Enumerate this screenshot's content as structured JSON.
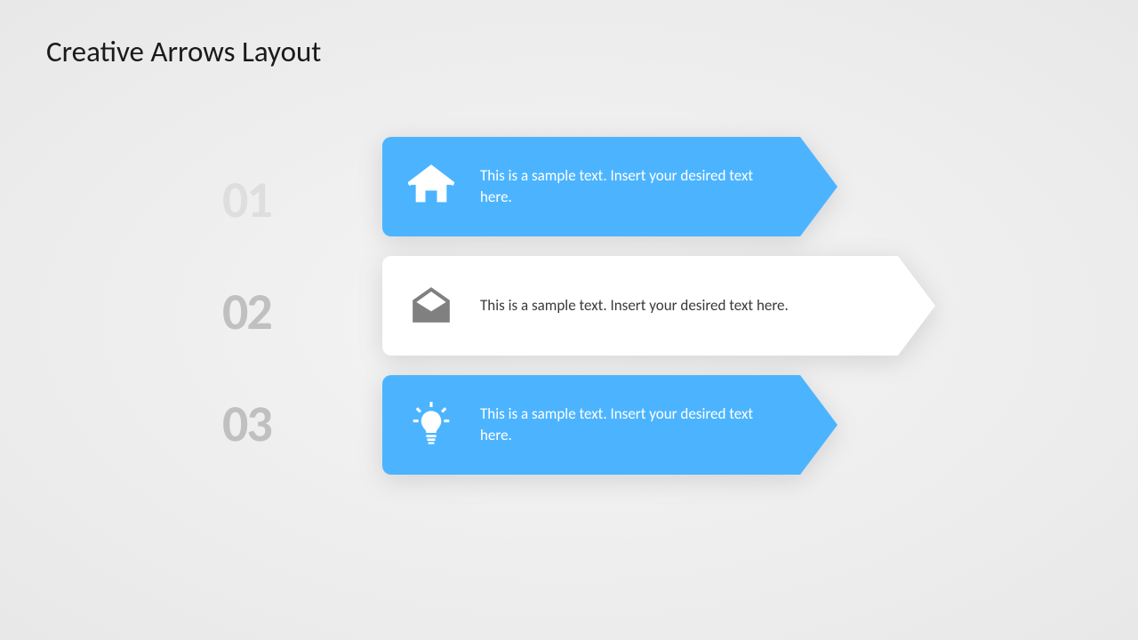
{
  "title": "Creative Arrows Layout",
  "items": [
    {
      "number": "01",
      "text": "This is a sample text. Insert your desired text here.",
      "icon": "house-icon"
    },
    {
      "number": "02",
      "text": "This is a sample text. Insert your desired text here.",
      "icon": "envelope-open-icon"
    },
    {
      "number": "03",
      "text": "This is a sample text. Insert your desired text here.",
      "icon": "lightbulb-icon"
    }
  ],
  "colors": {
    "accent": "#4cb4ff",
    "textDark": "#3a3a3a",
    "numberGray": "#c0c0c0"
  }
}
